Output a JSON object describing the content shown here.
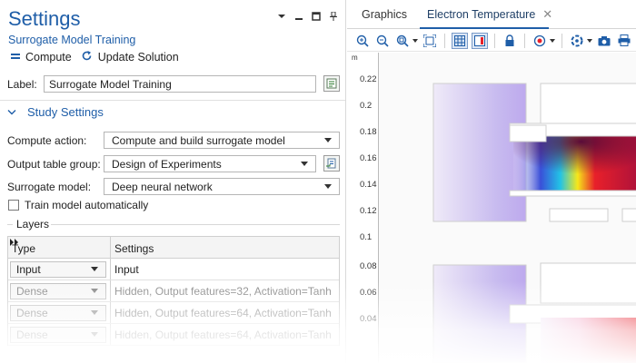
{
  "settings": {
    "title": "Settings",
    "subtitle": "Surrogate Model Training",
    "compute_label": "Compute",
    "update_label": "Update Solution",
    "label_caption": "Label:",
    "label_value": "Surrogate Model Training",
    "section_title": "Study Settings",
    "compute_action_label": "Compute action:",
    "compute_action_value": "Compute and build surrogate model",
    "output_group_label": "Output table group:",
    "output_group_value": "Design of Experiments",
    "surrogate_label": "Surrogate model:",
    "surrogate_value": "Deep neural network",
    "train_auto_label": "Train model automatically",
    "layers_label": "Layers",
    "table": {
      "headers": [
        "Type",
        "Settings"
      ],
      "rows": [
        {
          "type": "Input",
          "settings": "Input"
        },
        {
          "type": "Dense",
          "settings": "Hidden, Output features=32, Activation=Tanh"
        },
        {
          "type": "Dense",
          "settings": "Hidden, Output features=64, Activation=Tanh"
        },
        {
          "type": "Dense",
          "settings": "Hidden, Output features=64, Activation=Tanh"
        }
      ]
    }
  },
  "graphics": {
    "tab_graphics": "Graphics",
    "tab_active": "Electron Temperature",
    "axis_unit": "m",
    "y_ticks": [
      "0.22",
      "0.2",
      "0.18",
      "0.16",
      "0.14",
      "0.12",
      "0.1",
      "0.08",
      "0.06",
      "0.04"
    ],
    "toolbar_icons": [
      "zoom-in-icon",
      "zoom-out-icon",
      "zoom-box-icon",
      "zoom-extents-icon",
      "grid-icon",
      "axis-icon",
      "lock-icon",
      "scene-light-icon",
      "rotate-icon",
      "camera-icon",
      "print-icon"
    ]
  },
  "colors": {
    "accent": "#1f5ea8",
    "heat_dark": "#7a0c3a",
    "heat_red": "#e8202a",
    "heat_yellow": "#f6e71a",
    "heat_cyan": "#22c3e6",
    "heat_blue": "#3a4fd8",
    "heat_faint": "#d9d2f3"
  }
}
